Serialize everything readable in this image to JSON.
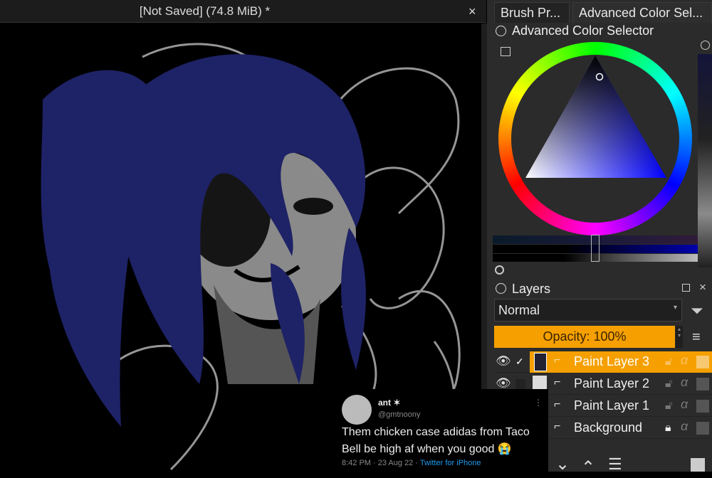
{
  "document": {
    "title": "[Not Saved]  (74.8 MiB) *",
    "close": "×"
  },
  "dock_tabs": [
    "Brush Pr...",
    "Advanced Color Sel..."
  ],
  "color_selector": {
    "title": "Advanced Color Selector",
    "current_color": "#1a1a9a"
  },
  "layers_panel": {
    "title": "Layers",
    "blend_mode": "Normal",
    "opacity_label": "Opacity:  100%",
    "accent": "#f5a000",
    "layers": [
      {
        "name": "Paint Layer 3",
        "selected": true,
        "visible": true
      },
      {
        "name": "Paint Layer 2",
        "selected": false,
        "visible": true
      },
      {
        "name": "Paint Layer 1",
        "selected": false,
        "visible": true
      },
      {
        "name": "Background",
        "selected": false,
        "visible": true,
        "locked": true
      }
    ]
  },
  "tweet": {
    "name": "ant ✶",
    "handle": "@gmtnoony",
    "text_line1": "Them chicken case adidas from Taco",
    "text_line2": "Bell be high af when you good 😭",
    "meta": "8:42 PM · 23 Aug 22 · ",
    "source": "Twitter for iPhone"
  }
}
